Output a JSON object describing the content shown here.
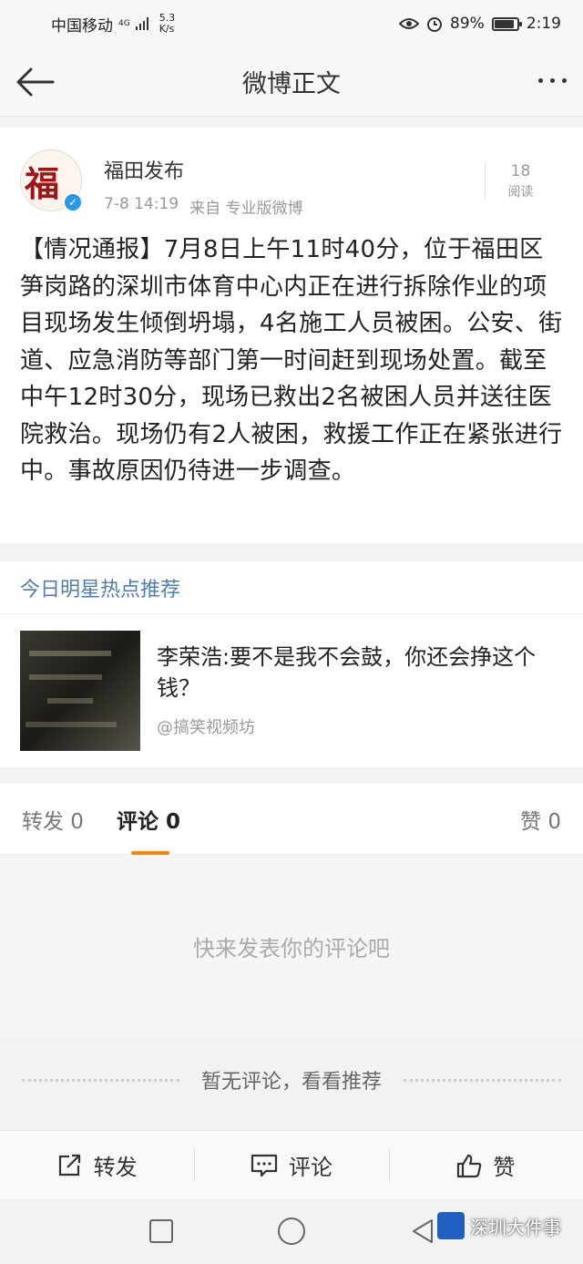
{
  "status": {
    "carrier": "中国移动",
    "network": "4G",
    "speed_value": "5.3",
    "speed_unit": "K/s",
    "battery": "89%",
    "battery_level": 0.89,
    "time": "2:19"
  },
  "header": {
    "title": "微博正文",
    "back_icon": "back-arrow-icon",
    "more_icon": "more-dots-icon"
  },
  "post": {
    "avatar_text": "福",
    "author": "福田发布",
    "date": "7-8 14:19",
    "source": "来自 专业版微博",
    "reads_count": "18",
    "reads_label": "阅读",
    "body": "【情况通报】7月8日上午11时40分，位于福田区笋岗路的深圳市体育中心内正在进行拆除作业的项目现场发生倾倒坍塌，4名施工人员被困。公安、街道、应急消防等部门第一时间赶到现场处置。截至中午12时30分，现场已救出2名被困人员并送往医院救治。现场仍有2人被困，救援工作正在紧张进行中。事故原因仍待进一步调查。"
  },
  "recommend": {
    "title": "今日明星热点推荐",
    "headline": "李荣浩:要不是我不会鼓，你还会挣这个钱？",
    "source": "@搞笑视频坊"
  },
  "tabs": {
    "repost": "转发 0",
    "comment": "评论 0",
    "like": "赞 0"
  },
  "comments": {
    "empty_text": "快来发表你的评论吧",
    "no_comment_text": "暂无评论，看看推荐"
  },
  "actions": {
    "repost": "转发",
    "comment": "评论",
    "like": "赞"
  },
  "watermark": {
    "text": "深圳大件事"
  },
  "colors": {
    "accent_orange": "#ff8200",
    "link_blue": "#507daf",
    "verified_blue": "#2a97e8"
  }
}
